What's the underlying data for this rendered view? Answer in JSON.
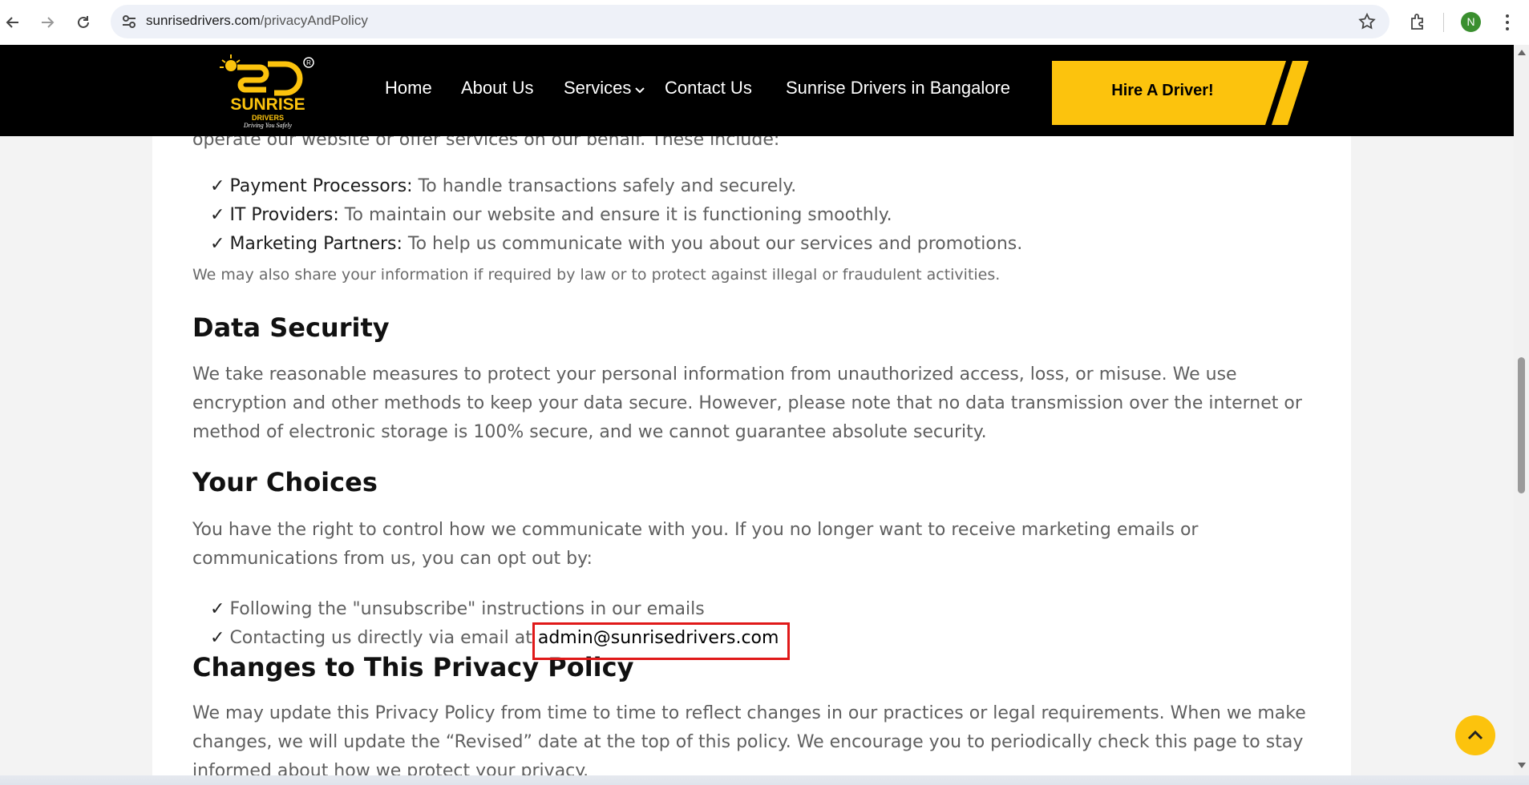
{
  "browser": {
    "url_domain": "sunrisedrivers.com",
    "url_path": "/privacyAndPolicy",
    "profile_initial": "N"
  },
  "header": {
    "logo_text": "SUNRISE",
    "logo_sub": "DRIVERS",
    "logo_tagline": "Driving You Safely",
    "nav": {
      "home": "Home",
      "about": "About Us",
      "services": "Services",
      "contact": "Contact Us",
      "bangalore": "Sunrise Drivers in Bangalore"
    },
    "cta_label": "Hire A Driver!",
    "cta_color": "#fcc30d"
  },
  "content": {
    "clipped_intro": "operate our website or offer services on our behalf. These include:",
    "third_parties": [
      {
        "term": "Payment Processors:",
        "desc": " To handle transactions safely and securely."
      },
      {
        "term": "IT Providers:",
        "desc": " To maintain our website and ensure it is functioning smoothly."
      },
      {
        "term": "Marketing Partners:",
        "desc": " To help us communicate with you about our services and promotions."
      }
    ],
    "legal_note": "We may also share your information if required by law or to protect against illegal or fraudulent activities.",
    "data_security": {
      "heading": "Data Security",
      "body": "We take reasonable measures to protect your personal information from unauthorized access, loss, or misuse. We use encryption and other methods to keep your data secure. However, please note that no data transmission over the internet or method of electronic storage is 100% secure, and we cannot guarantee absolute security."
    },
    "your_choices": {
      "heading": "Your Choices",
      "body": "You have the right to control how we communicate with you. If you no longer want to receive marketing emails or communications from us, you can opt out by:",
      "items": [
        "Following the \"unsubscribe\" instructions in our emails",
        "Contacting us directly via email at "
      ],
      "email": "admin@sunrisedrivers.com"
    },
    "changes": {
      "heading": "Changes to This Privacy Policy",
      "body": "We may update this Privacy Policy from time to time to reflect changes in our practices or legal requirements. When we make changes, we will update the “Revised” date at the top of this policy. We encourage you to periodically check this page to stay informed about how we protect your privacy."
    }
  },
  "check_mark": "✓",
  "colors": {
    "highlight": "#e01919",
    "back_to_top": "#fcc30d"
  }
}
